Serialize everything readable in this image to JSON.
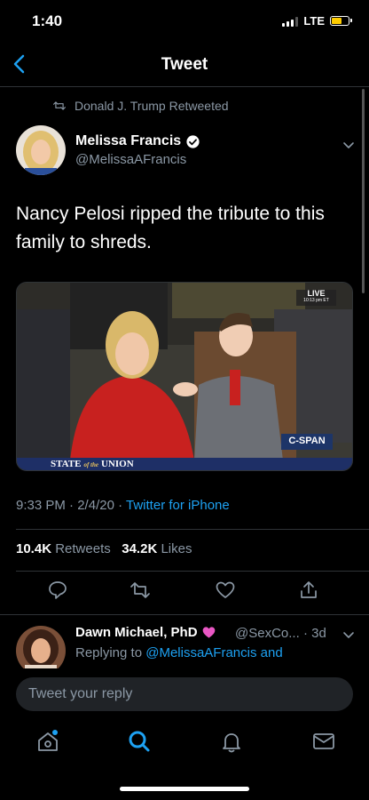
{
  "status": {
    "time": "1:40",
    "network": "LTE"
  },
  "nav": {
    "title": "Tweet"
  },
  "tweet": {
    "retweeted_by": "Donald J. Trump Retweeted",
    "author_name": "Melissa Francis",
    "author_handle": "@MelissaAFrancis",
    "text": "Nancy Pelosi ripped the tribute to this family to shreds.",
    "media": {
      "live_label": "LIVE",
      "live_time": "10:13 pm ET",
      "network_logo": "C-SPAN",
      "caption_left": "STATE",
      "caption_of_the": "of the",
      "caption_right": "UNION"
    },
    "time": "9:33 PM",
    "date": "2/4/20",
    "source": "Twitter for iPhone",
    "retweets_count": "10.4K",
    "retweets_label": "Retweets",
    "likes_count": "34.2K",
    "likes_label": "Likes"
  },
  "reply": {
    "name": "Dawn Michael, PhD",
    "handle": "@SexCo...",
    "age": "· 3d",
    "replying_prefix": "Replying to",
    "replying_to": "@MelissaAFrancis and"
  },
  "compose": {
    "placeholder": "Tweet your reply"
  },
  "icons": [
    "back-icon",
    "retweet-icon",
    "verified-icon",
    "chevron-down-icon",
    "reply-icon",
    "like-icon",
    "share-icon",
    "heart-icon",
    "home-icon",
    "search-icon",
    "notifications-icon",
    "messages-icon"
  ],
  "colors": {
    "accent": "#1da1f2",
    "secondary_text": "#8b98a5",
    "background": "#000000"
  }
}
